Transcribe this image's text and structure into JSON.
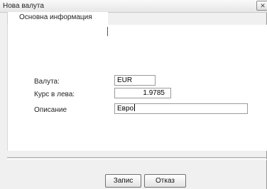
{
  "window": {
    "title": "Нова валута",
    "close_glyph": "✕"
  },
  "tabs": [
    {
      "label": "Основна информация",
      "selected": true
    }
  ],
  "form": {
    "currency": {
      "label": "Валута:",
      "value": "EUR"
    },
    "rate": {
      "label": "Курс в лева:",
      "value": "1.9785"
    },
    "description": {
      "label": "Описание",
      "value": "Евро"
    }
  },
  "buttons": {
    "save_label": "Запис",
    "cancel_label": "Отказ"
  }
}
